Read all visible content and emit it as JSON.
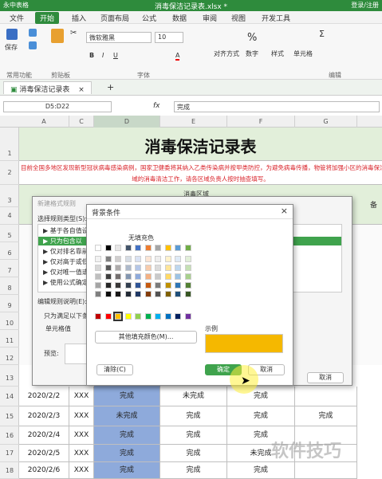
{
  "app": {
    "name": "永中表格",
    "title": "消毒保洁记录表.xlsx *",
    "user": "登录/注册"
  },
  "menus": [
    "文件",
    "开始",
    "插入",
    "页面布局",
    "公式",
    "数据",
    "审阅",
    "视图",
    "开发工具"
  ],
  "ribbon": {
    "save": "保存",
    "clipboard_group": "剪贴板",
    "common_group": "常用功能",
    "font_name": "微软雅黑",
    "font_size": "10",
    "font_group": "字体",
    "bold": "B",
    "italic": "I",
    "underline": "U",
    "font_color": "A",
    "align": "对齐方式",
    "number": "数字",
    "style": "样式",
    "cell": "单元格",
    "edit_group": "编辑",
    "percent": "%",
    "sum": "Σ"
  },
  "sheet_tab": "消毒保洁记录表",
  "formula_bar": {
    "name_box": "D5:D22",
    "fx": "fx",
    "value": "完成"
  },
  "columns": [
    "A",
    "C",
    "D",
    "E",
    "F",
    "G"
  ],
  "rows": [
    "1",
    "2",
    "3",
    "4",
    "5",
    "6",
    "7",
    "8",
    "9",
    "10",
    "11",
    "12",
    "13",
    "14",
    "15",
    "16",
    "17",
    "18"
  ],
  "sheet": {
    "title": "消毒保洁记录表",
    "notice": "目前全国多地区发现新型冠状病毒感染病例，国家卫健委将其纳入乙类传染病并按甲类防控，为避免病毒传播，物管将加强小区的消毒保洁，责任到人，请各小区",
    "notice2": "域的消毒清洁工作，请各区域负责人按时抽查填写。",
    "header_area": "消毒区域",
    "header_remark": "备",
    "data": [
      {
        "date": "2020/2/2",
        "person": "XXX",
        "d": "完成",
        "e": "未完成",
        "f": "完成",
        "g": ""
      },
      {
        "date": "2020/2/3",
        "person": "XXX",
        "d": "未完成",
        "e": "完成",
        "f": "完成",
        "g": "完成"
      },
      {
        "date": "2020/2/4",
        "person": "XXX",
        "d": "完成",
        "e": "完成",
        "f": "完成",
        "g": ""
      },
      {
        "date": "2020/2/5",
        "person": "XXX",
        "d": "完成",
        "e": "完成",
        "f": "未完成",
        "g": ""
      },
      {
        "date": "2020/2/6",
        "person": "XXX",
        "d": "完成",
        "e": "完成",
        "f": "完成",
        "g": ""
      }
    ]
  },
  "rule_dialog": {
    "title": "新建格式规则",
    "select_type": "选择规则类型(S):",
    "types": [
      "基于各自值设置",
      "只为包含以",
      "仅对排名靠前",
      "仅对高于或低",
      "仅对唯一值或",
      "使用公式确定"
    ],
    "edit_desc": "编辑规则说明(E):",
    "only_for": "只为满足以下条",
    "cell_value": "单元格值",
    "preview": "预览:",
    "cancel": "取消"
  },
  "fill_dialog": {
    "title": "背景条件",
    "no_fill": "无填充色",
    "more_colors": "其他填充颜色(M)...",
    "sample": "示例",
    "sample_color": "#f5b800",
    "clear": "清除(C)",
    "ok": "确定",
    "cancel": "取消",
    "close": "×"
  },
  "watermark": "软件技巧",
  "colors": {
    "accent": "#2e8b3c",
    "title_bg": "#e2efda",
    "notice_red": "#d9232a",
    "selection": "#8eaadb",
    "row1": [
      "#ffffff",
      "#000000",
      "#e7e6e6",
      "#44546a",
      "#4472c4",
      "#ed7d31",
      "#a5a5a5",
      "#ffc000",
      "#5b9bd5",
      "#70ad47"
    ],
    "shade1": [
      "#f2f2f2",
      "#7f7f7f",
      "#d0cece",
      "#d6dce4",
      "#d9e2f3",
      "#fbe5d5",
      "#ededed",
      "#fff2cc",
      "#deeaf6",
      "#e2efd9"
    ],
    "shade2": [
      "#d8d8d8",
      "#595959",
      "#aeabab",
      "#adb9ca",
      "#b4c6e7",
      "#f7cbac",
      "#dbdbdb",
      "#fee599",
      "#bdd7ee",
      "#c5e0b3"
    ],
    "shade3": [
      "#bfbfbf",
      "#3f3f3f",
      "#757070",
      "#8496b0",
      "#8eaadb",
      "#f4b183",
      "#c9c9c9",
      "#ffd966",
      "#9cc3e5",
      "#a8d08d"
    ],
    "shade4": [
      "#a5a5a5",
      "#262626",
      "#3a3838",
      "#323f4f",
      "#2f5496",
      "#c55a11",
      "#7b7b7b",
      "#bf9000",
      "#2e75b5",
      "#538135"
    ],
    "shade5": [
      "#7f7f7f",
      "#0c0c0c",
      "#171616",
      "#222a35",
      "#1f3864",
      "#833c0b",
      "#525252",
      "#7f6000",
      "#1e4e79",
      "#375623"
    ],
    "standard": [
      "#c00000",
      "#ff0000",
      "#ffc000",
      "#ffff00",
      "#92d050",
      "#00b050",
      "#00b0f0",
      "#0070c0",
      "#002060",
      "#7030a0"
    ]
  }
}
